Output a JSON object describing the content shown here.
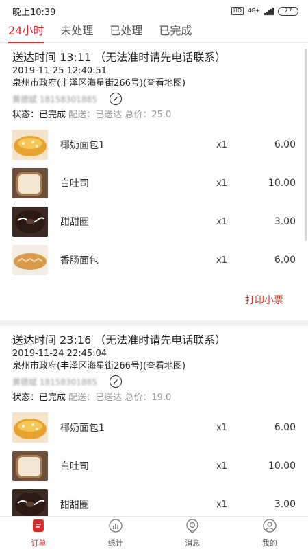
{
  "statusbar": {
    "time": "晚上10:39",
    "hd": "HD",
    "network": "4G+",
    "battery": "77"
  },
  "tabs": [
    {
      "label": "24小时",
      "active": true
    },
    {
      "label": "未处理",
      "active": false
    },
    {
      "label": "已处理",
      "active": false
    },
    {
      "label": "已完成",
      "active": false
    }
  ],
  "orders": [
    {
      "title": "送达时间 13:11 （无法准时请先电话联系）",
      "time": "2019-11-25 12:40:51",
      "address": "泉州市政府(丰泽区海星街266号)(查看地图)",
      "contact_name": "黄德斌",
      "contact_phone": "18158301885",
      "status_label": "状态：",
      "status_value": "已完成",
      "delivery": "配送：已送达",
      "total": "总价：25.0",
      "items": [
        {
          "name": "椰奶面包1",
          "qty": "x1",
          "price": "6.00",
          "thumb": "coconut-bread"
        },
        {
          "name": "白吐司",
          "qty": "x1",
          "price": "10.00",
          "thumb": "toast"
        },
        {
          "name": "甜甜圈",
          "qty": "x1",
          "price": "3.00",
          "thumb": "donut"
        },
        {
          "name": "香肠面包",
          "qty": "x1",
          "price": "6.00",
          "thumb": "sausage-bread"
        }
      ],
      "print_label": "打印小票"
    },
    {
      "title": "送达时间 23:16 （无法准时请先电话联系）",
      "time": "2019-11-24 22:45:04",
      "address": "泉州市政府(丰泽区海星街266号)(查看地图)",
      "contact_name": "黄德斌",
      "contact_phone": "18158301885",
      "status_label": "状态：",
      "status_value": "已完成",
      "delivery": "配送：已送达",
      "total": "总价：19.0",
      "items": [
        {
          "name": "椰奶面包1",
          "qty": "x1",
          "price": "6.00",
          "thumb": "coconut-bread"
        },
        {
          "name": "白吐司",
          "qty": "x1",
          "price": "10.00",
          "thumb": "toast"
        },
        {
          "name": "甜甜圈",
          "qty": "x1",
          "price": "3.00",
          "thumb": "donut"
        }
      ]
    }
  ],
  "bottomnav": [
    {
      "label": "订单",
      "icon": "orders-icon",
      "active": true
    },
    {
      "label": "统计",
      "icon": "stats-icon",
      "active": false
    },
    {
      "label": "消息",
      "icon": "message-icon",
      "active": false
    },
    {
      "label": "我的",
      "icon": "profile-icon",
      "active": false
    }
  ],
  "colors": {
    "accent": "#e02a2a",
    "muted": "#999999"
  }
}
